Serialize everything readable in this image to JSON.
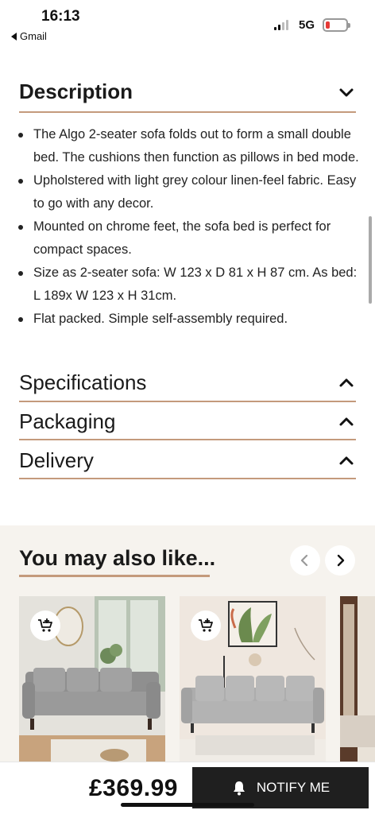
{
  "status_bar": {
    "time": "16:13",
    "back_app": "Gmail",
    "network": "5G"
  },
  "description": {
    "title": "Description",
    "bullets": [
      "The Algo 2-seater sofa folds out to form a small double bed. The cushions then function as pillows in bed mode.",
      "Upholstered with light grey colour linen-feel fabric. Easy to go with any decor.",
      "Mounted on chrome feet, the sofa bed is perfect for compact spaces.",
      "Size as 2-seater sofa: W 123 x D 81 x H 87 cm. As bed: L 189x W 123 x H 31cm.",
      "Flat packed. Simple self-assembly required."
    ]
  },
  "sections": [
    {
      "title": "Specifications"
    },
    {
      "title": "Packaging"
    },
    {
      "title": "Delivery"
    }
  ],
  "also_like": {
    "title": "You may also like..."
  },
  "bottom_bar": {
    "price": "£369.99",
    "notify_label": "NOTIFY ME"
  },
  "colors": {
    "accent_rule": "#c49a7c",
    "button_dark": "#1f1f1f",
    "section_bg": "#f6f3ee"
  },
  "icons": [
    "chevron-down-icon",
    "chevron-up-icon",
    "chevron-left-icon",
    "chevron-right-icon",
    "add-to-cart-icon",
    "bell-icon"
  ]
}
